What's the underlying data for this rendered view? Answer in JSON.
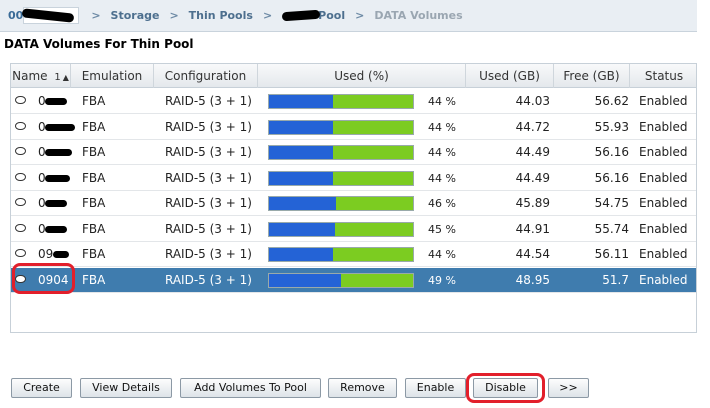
{
  "breadcrumb": {
    "root_prefix": "00",
    "storage": "Storage",
    "thin_pools": "Thin Pools",
    "pool_suffix": "Pool",
    "current": "DATA Volumes",
    "separator": ">"
  },
  "page_title": "DATA Volumes For Thin Pool",
  "table": {
    "columns": {
      "name": "Name",
      "name_sort": "1",
      "emulation": "Emulation",
      "configuration": "Configuration",
      "used_pct": "Used (%)",
      "used_gb": "Used (GB)",
      "free_gb": "Free (GB)",
      "status": "Status"
    },
    "rows": [
      {
        "name": "0",
        "emulation": "FBA",
        "configuration": "RAID-5 (3 + 1)",
        "used_pct": "44 %",
        "used_fraction": 0.44,
        "used_gb": "44.03",
        "free_gb": "56.62",
        "status": "Enabled"
      },
      {
        "name": "0",
        "emulation": "FBA",
        "configuration": "RAID-5 (3 + 1)",
        "used_pct": "44 %",
        "used_fraction": 0.44,
        "used_gb": "44.72",
        "free_gb": "55.93",
        "status": "Enabled"
      },
      {
        "name": "0",
        "emulation": "FBA",
        "configuration": "RAID-5 (3 + 1)",
        "used_pct": "44 %",
        "used_fraction": 0.44,
        "used_gb": "44.49",
        "free_gb": "56.16",
        "status": "Enabled"
      },
      {
        "name": "0",
        "emulation": "FBA",
        "configuration": "RAID-5 (3 + 1)",
        "used_pct": "44 %",
        "used_fraction": 0.44,
        "used_gb": "44.49",
        "free_gb": "56.16",
        "status": "Enabled"
      },
      {
        "name": "0",
        "emulation": "FBA",
        "configuration": "RAID-5 (3 + 1)",
        "used_pct": "46 %",
        "used_fraction": 0.46,
        "used_gb": "45.89",
        "free_gb": "54.75",
        "status": "Enabled"
      },
      {
        "name": "0",
        "emulation": "FBA",
        "configuration": "RAID-5 (3 + 1)",
        "used_pct": "45 %",
        "used_fraction": 0.45,
        "used_gb": "44.91",
        "free_gb": "55.74",
        "status": "Enabled"
      },
      {
        "name": "09",
        "emulation": "FBA",
        "configuration": "RAID-5 (3 + 1)",
        "used_pct": "44 %",
        "used_fraction": 0.44,
        "used_gb": "44.54",
        "free_gb": "56.11",
        "status": "Enabled"
      },
      {
        "name": "0904",
        "emulation": "FBA",
        "configuration": "RAID-5 (3 + 1)",
        "used_pct": "49 %",
        "used_fraction": 0.49,
        "used_gb": "48.95",
        "free_gb": "51.7",
        "status": "Enabled",
        "selected": true
      }
    ]
  },
  "buttons": {
    "create": "Create",
    "view_details": "View Details",
    "add_volumes": "Add Volumes To Pool",
    "remove": "Remove",
    "enable": "Enable",
    "disable": "Disable",
    "more": ">>"
  },
  "colors": {
    "used_bar": "#2463d6",
    "free_bar": "#7ccc21",
    "selected_row": "#3f7cae",
    "highlight": "#e21f2b"
  }
}
